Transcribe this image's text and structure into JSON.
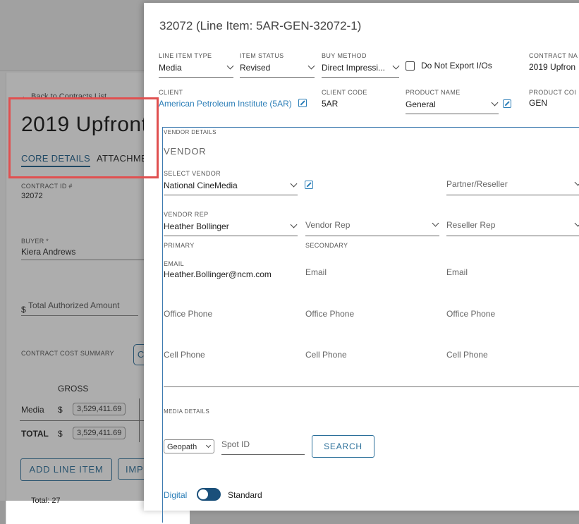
{
  "background": {
    "back_link": "← Back to Contracts List",
    "title": "2019 Upfront",
    "tabs": [
      "CORE DETAILS",
      "ATTACHME"
    ],
    "contract_id_label": "CONTRACT ID #",
    "contract_id": "32072",
    "buyer_label": "BUYER *",
    "buyer": "Kiera Andrews",
    "currency_symbol": "$",
    "total_authorized_placeholder": "Total Authorized Amount",
    "cost_summary_label": "CONTRACT COST SUMMARY",
    "gross_header": "GROSS",
    "rows": [
      {
        "label": "Media",
        "currency": "$",
        "amount": "3,529,411.69"
      },
      {
        "label": "TOTAL",
        "currency": "$",
        "amount": "3,529,411.69"
      }
    ],
    "add_line_item": "ADD LINE ITEM",
    "imp_button": "IMP",
    "total_text": "Total: 27",
    "partial_button_letter": "C"
  },
  "modal": {
    "title": "32072 (Line Item: 5AR-GEN-32072-1)",
    "row1": {
      "line_item_type": {
        "label": "LINE ITEM TYPE",
        "value": "Media"
      },
      "item_status": {
        "label": "ITEM STATUS",
        "value": "Revised"
      },
      "buy_method": {
        "label": "BUY METHOD",
        "value": "Direct Impressi..."
      },
      "do_not_export": "Do Not Export I/Os",
      "contract_name": {
        "label": "CONTRACT NA",
        "value": "2019 Upfron"
      }
    },
    "row2": {
      "client": {
        "label": "CLIENT",
        "value": "American Petroleum Institute (5AR)"
      },
      "client_code": {
        "label": "CLIENT CODE",
        "value": "5AR"
      },
      "product_name": {
        "label": "PRODUCT NAME",
        "value": "General"
      },
      "product_code": {
        "label": "PRODUCT COI",
        "value": "GEN"
      }
    },
    "vendor": {
      "section_label": "VENDOR DETAILS",
      "heading": "VENDOR",
      "select_vendor_label": "SELECT VENDOR",
      "select_vendor_value": "National CineMedia",
      "partner_placeholder": "Partner/Reseller",
      "vendor_rep_label": "VENDOR REP",
      "vendor_rep_value": "Heather Bollinger",
      "vendor_rep2_placeholder": "Vendor Rep",
      "reseller_rep_placeholder": "Reseller Rep",
      "primary": "PRIMARY",
      "secondary": "SECONDARY",
      "email_label": "EMAIL",
      "email_value": "Heather.Bollinger@ncm.com",
      "email_placeholder": "Email",
      "office_phone": "Office Phone",
      "cell_phone": "Cell Phone"
    },
    "media": {
      "section_label": "MEDIA DETAILS",
      "source_select": "Geopath",
      "spot_id_placeholder": "Spot ID",
      "search_button": "SEARCH",
      "toggle_left": "Digital",
      "toggle_right": "Standard"
    }
  },
  "colors": {
    "accent": "#2d7fb8",
    "highlight_box": "#e05050",
    "toggle": "#1a4f7a"
  }
}
